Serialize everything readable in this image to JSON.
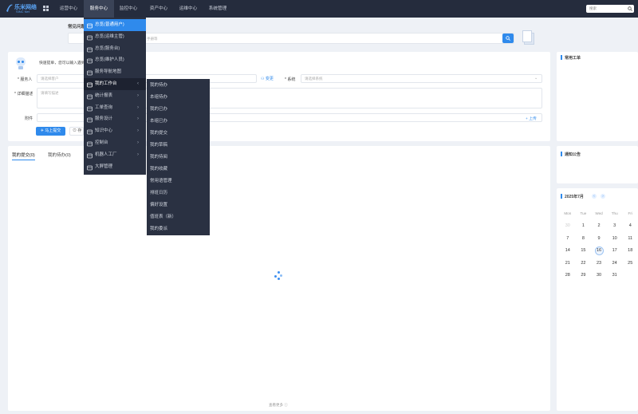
{
  "brand": {
    "name": "乐米网络",
    "sub": "SINC Net"
  },
  "nav": [
    "运营中心",
    "服务中心",
    "监控中心",
    "资产中心",
    "运维中心",
    "系统管理"
  ],
  "search": {
    "placeholder": "搜索"
  },
  "faq": {
    "title": "常见问题",
    "placeholder": "请输入需要查询的问题或者手册等",
    "tail": "手册等"
  },
  "form": {
    "tip": "快速提单，您可以输入遇到的问题…",
    "requester_label": "* 服务人",
    "requester_ph": "请选择客户",
    "change": "变更",
    "system_label": "* 系统",
    "system_ph": "请选择系统",
    "desc_label": "* 详细描述",
    "desc_ph": "请填写描述",
    "attach_label": "附件",
    "upload": "上传",
    "submit": "马上提交",
    "save": "存"
  },
  "tabs": {
    "my_submit": "我的提交(0)",
    "my_todo": "我的待办(0)"
  },
  "more": "查看更多",
  "right": {
    "common": "常用工单",
    "notice": "通知公告",
    "cal_title": "2025年7月"
  },
  "calendar": {
    "weekdays": [
      "Mon",
      "Tue",
      "Wed",
      "Thu",
      "Fri"
    ],
    "weeks": [
      [
        "30",
        "1",
        "2",
        "3",
        "4"
      ],
      [
        "7",
        "8",
        "9",
        "10",
        "11"
      ],
      [
        "14",
        "15",
        "16",
        "17",
        "18"
      ],
      [
        "21",
        "22",
        "23",
        "24",
        "25"
      ],
      [
        "28",
        "29",
        "30",
        "31",
        ""
      ]
    ],
    "today": "16"
  },
  "menu": [
    {
      "label": "总览(普通用户)",
      "arrow": ""
    },
    {
      "label": "总览(运维主管)",
      "arrow": ""
    },
    {
      "label": "总览(服务台)",
      "arrow": ""
    },
    {
      "label": "总览(维护人员)",
      "arrow": ""
    },
    {
      "label": "服务导航地图",
      "arrow": ""
    },
    {
      "label": "我的工作台",
      "arrow": "‹"
    },
    {
      "label": "统计报表",
      "arrow": "›"
    },
    {
      "label": "工单查询",
      "arrow": "›"
    },
    {
      "label": "服务设计",
      "arrow": "›"
    },
    {
      "label": "知识中心",
      "arrow": "›"
    },
    {
      "label": "控制台",
      "arrow": "›"
    },
    {
      "label": "机器人工厂",
      "arrow": "›"
    },
    {
      "label": "大屏管理",
      "arrow": ""
    }
  ],
  "submenu": [
    "我的待办",
    "本组待办",
    "我的已办",
    "本组已办",
    "我的提交",
    "我的草稿",
    "我的待阅",
    "我的收藏",
    "常用语管理",
    "排班日历",
    "偏好设置",
    "值班表（新）",
    "我的委派"
  ],
  "colors": {
    "topbar": "#252c3d",
    "accent": "#2f8aec",
    "menu": "#2a3142"
  }
}
